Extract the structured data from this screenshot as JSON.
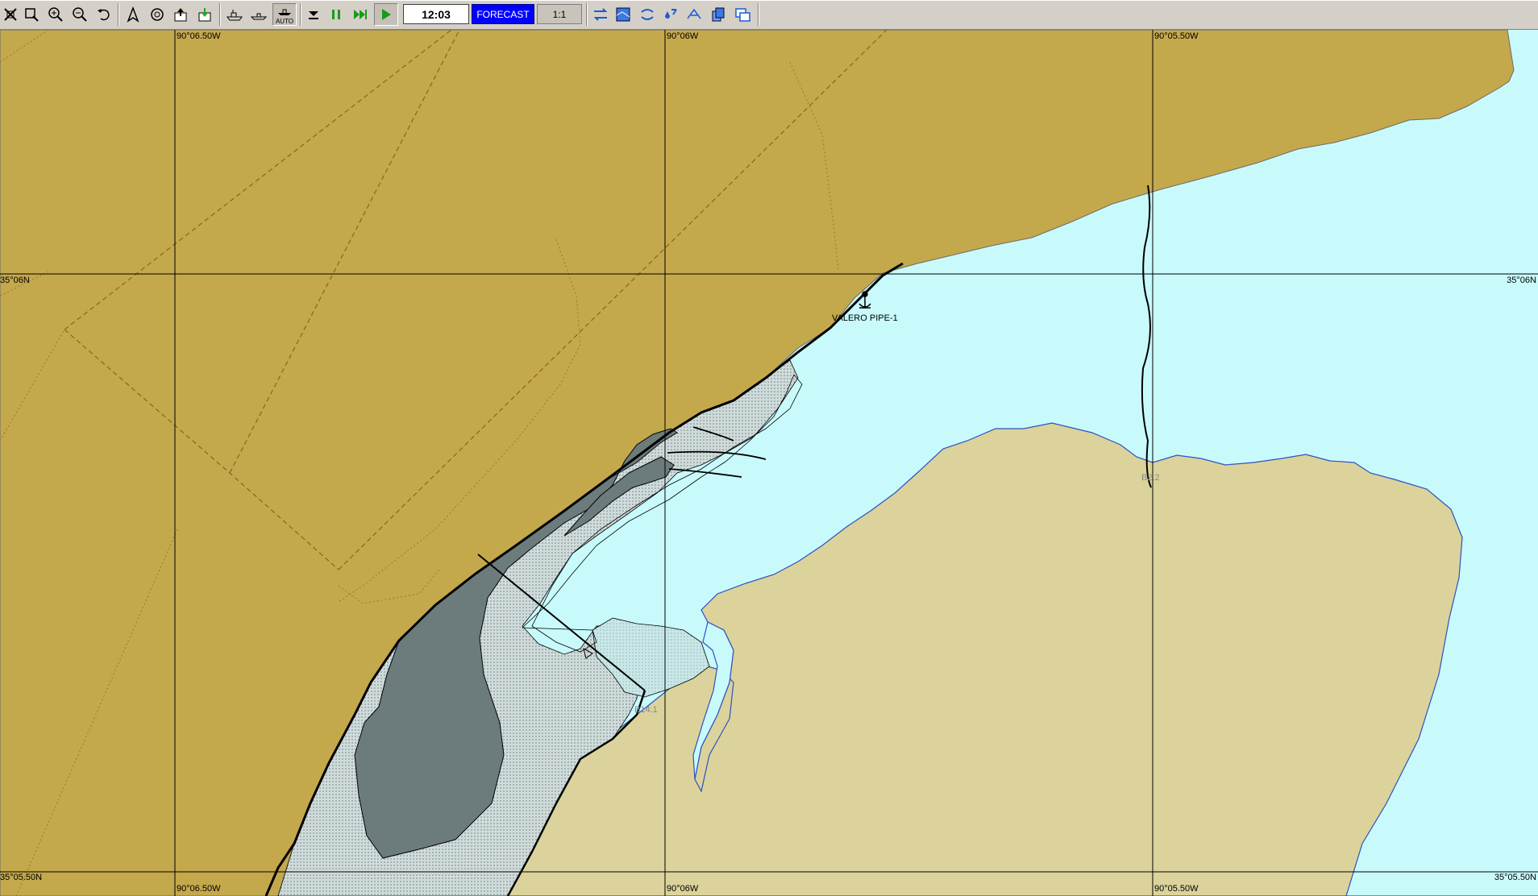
{
  "toolbar": {
    "time": "12:03",
    "forecast_label": "FORECAST",
    "scale_label": "1:1",
    "auto_label": "AUTO",
    "buttons": [
      "exit-icon",
      "select-area-icon",
      "zoom-in-icon",
      "zoom-out-icon",
      "undo-icon",
      "north-arrow-icon",
      "target-icon",
      "export-icon",
      "import-icon",
      "ship-icon",
      "ship-outline-icon",
      "auto-ship-icon",
      "download-icon",
      "pause-icon",
      "fast-forward-icon",
      "play-icon",
      "layers-arrows-icon",
      "chart-layers-icon",
      "route-icon",
      "water-drop-icon",
      "aircraft-icon",
      "copy-layers-icon",
      "windows-icon"
    ]
  },
  "chart": {
    "longitude_labels": [
      "90°06.50W",
      "90°06W",
      "90°05.50W"
    ],
    "latitude_labels": [
      "35°06N",
      "35°05.50N"
    ],
    "feature_label": "VALERO PIPE-1",
    "depth_labels": [
      "B2.2",
      "B14.1"
    ],
    "colors": {
      "land": "#c4a84c",
      "water": "#c8fafc",
      "shoal": "#dbd39b",
      "marsh": "#6c7c7c",
      "grid": "#000000"
    }
  }
}
